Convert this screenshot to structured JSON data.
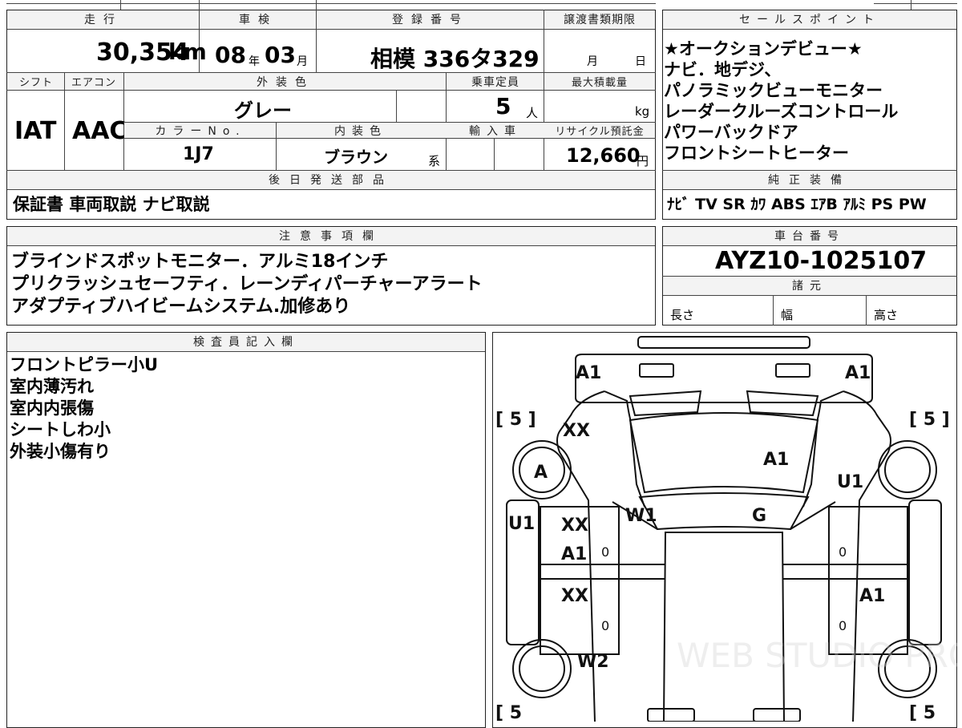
{
  "vehicle_summary": {
    "mileage": {
      "label": "走行",
      "value": "30,354",
      "unit": "km"
    },
    "shaken": {
      "label": "車検",
      "year": "08",
      "year_unit": "年",
      "month": "03",
      "month_unit": "月"
    },
    "registration": {
      "label": "登録番号",
      "value": "相模 336タ329"
    },
    "transfer_deadline": {
      "label": "譲渡書類期限",
      "month_unit": "月",
      "day_unit": "日"
    }
  },
  "specs": {
    "shift": {
      "label": "シフト",
      "value": "IAT"
    },
    "aircon": {
      "label": "エアコン",
      "value": "AAC"
    },
    "exterior_color": {
      "label": "外装色",
      "value": "グレー"
    },
    "capacity": {
      "label": "乗車定員",
      "value": "5",
      "unit": "人"
    },
    "max_load": {
      "label": "最大積載量",
      "unit": "kg"
    },
    "color_no": {
      "label": "カラーNo.",
      "value": "1J7"
    },
    "interior_color": {
      "label": "内装色",
      "value": "ブラウン",
      "suffix": "系"
    },
    "import": {
      "label": "輸入車"
    },
    "recycle": {
      "label": "リサイクル預託金",
      "value": "12,660",
      "unit": "円"
    }
  },
  "later_shipment": {
    "label": "後日発送部品",
    "value": "保証書 車両取説 ナビ取説"
  },
  "sales_points": {
    "label": "セールスポイント",
    "lines": [
      "★オークションデビュー★",
      "ナビ．地デジ、",
      "パノラミックビューモニター",
      "レーダークルーズコントロール",
      "パワーバックドア",
      "フロントシートヒーター"
    ]
  },
  "genuine_equipment": {
    "label": "純正装備",
    "value": "ﾅﾋﾞ TV SR ｶﾜ ABS ｴｱB ｱﾙﾐ PS PW"
  },
  "notes": {
    "label": "注意事項欄",
    "lines": [
      "ブラインドスポットモニター．アルミ18インチ",
      "プリクラッシュセーフティ．レーンディパーチャーアラート",
      "アダプティブハイビームシステム.加修あり"
    ]
  },
  "chassis": {
    "label": "車台番号",
    "value": "AYZ10-1025107"
  },
  "dimensions": {
    "label": "諸元",
    "length": "長さ",
    "width": "幅",
    "height": "高さ"
  },
  "inspector": {
    "label": "検査員記入欄",
    "lines": [
      "フロントピラー小U",
      "室内薄汚れ",
      "室内内張傷",
      "シートしわ小",
      "外装小傷有り"
    ]
  },
  "diagram": {
    "tire_top_left": "[ 5 ]",
    "tire_top_right": "[ 5 ]",
    "tire_bottom_left": "[ 5",
    "tire_bottom_right": "[ 5",
    "front_left": "A1",
    "front_right": "A1",
    "front_left_fender": "XX",
    "front_left_wheel": "A",
    "hood": "A1",
    "front_right_fender": "U1",
    "left_pillar": "U1",
    "windshield_left": "W1",
    "roof_front": "G",
    "front_left_door_1": "XX",
    "front_left_door_2": "A1",
    "rear_left_door": "XX",
    "rear_right_door": "A1",
    "rear_left_wheel": "W2",
    "zero": "0",
    "watermark": "WEB STUDIO PRO"
  }
}
